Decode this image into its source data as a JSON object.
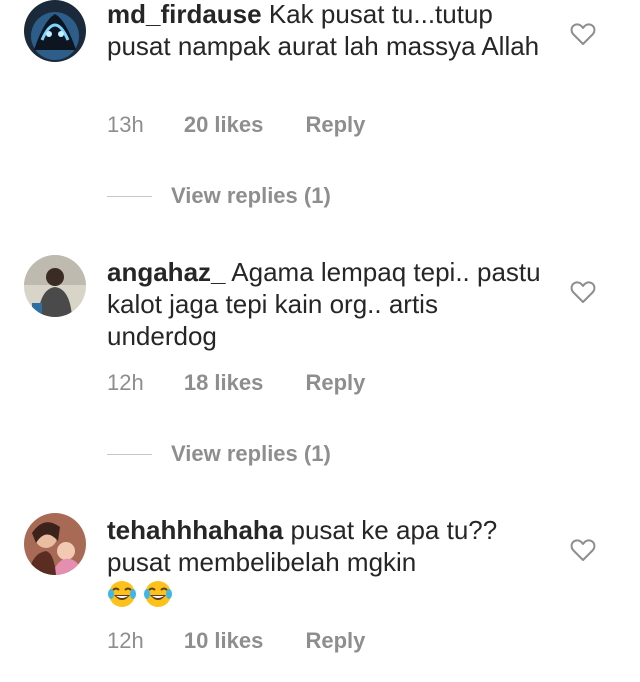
{
  "comments": [
    {
      "username": "md_firdause",
      "text": "Kak pusat tu...tutup pusat nampak aurat lah massya Allah",
      "time": "13h",
      "likes": "20 likes",
      "reply": "Reply",
      "view_replies": "View replies (1)",
      "icon": "heart-outline-icon"
    },
    {
      "username": "angahaz_",
      "text": "Agama lempaq tepi.. pastu kalot jaga tepi kain org.. artis underdog",
      "time": "12h",
      "likes": "18 likes",
      "reply": "Reply",
      "view_replies": "View replies (1)",
      "icon": "heart-outline-icon"
    },
    {
      "username": "tehahhhahaha",
      "text": "pusat ke apa tu?? pusat membelibelah mgkin",
      "emojis": [
        "face-with-tears-of-joy",
        "face-with-tears-of-joy"
      ],
      "time": "12h",
      "likes": "10 likes",
      "reply": "Reply",
      "icon": "heart-outline-icon"
    }
  ],
  "colors": {
    "text": "#262626",
    "meta": "#8e8e8e",
    "divider": "#c7c7c7"
  }
}
